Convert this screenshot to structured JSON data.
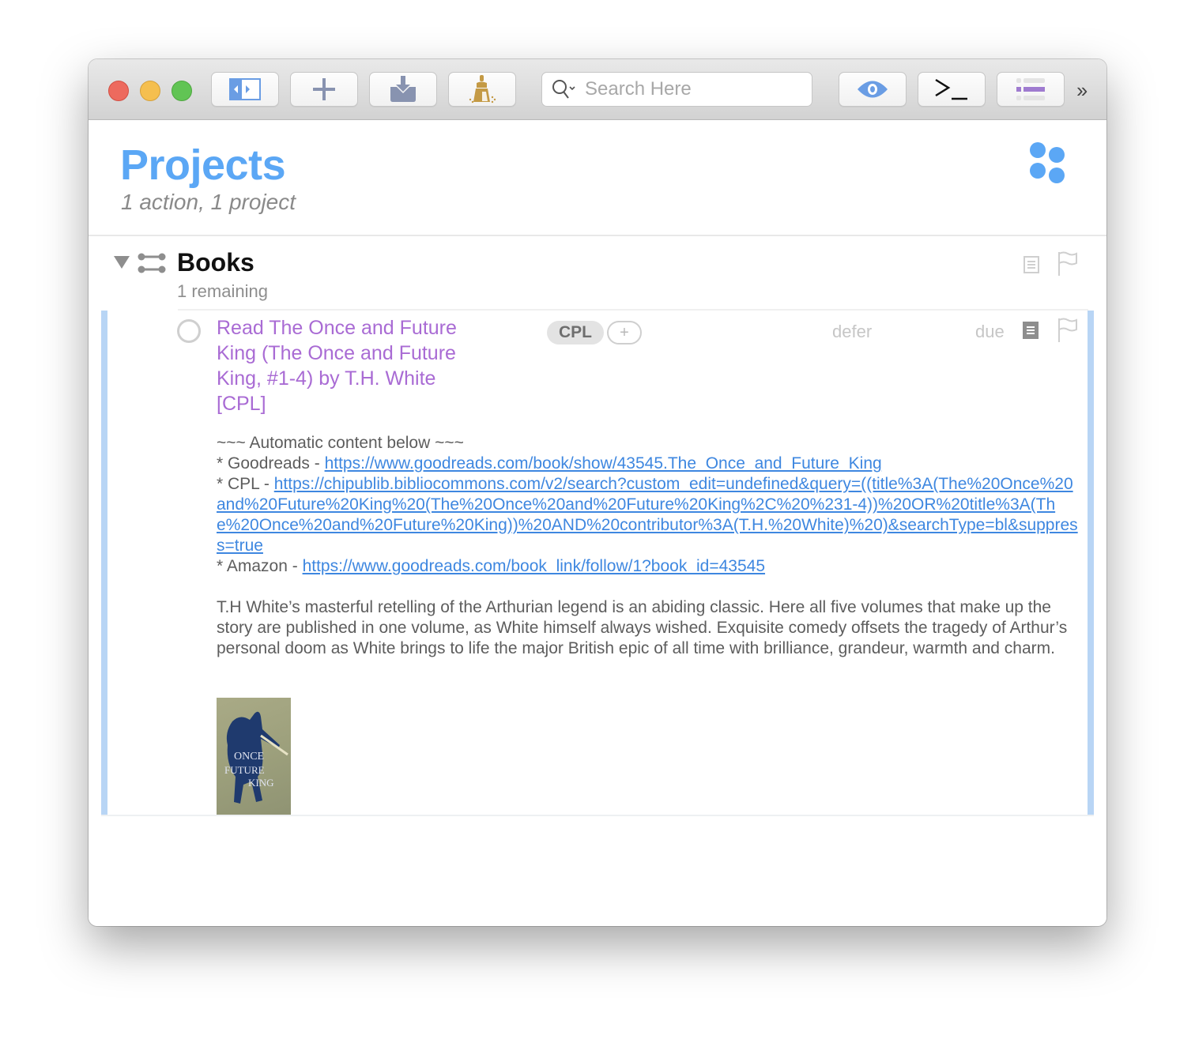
{
  "window": {
    "traffic_lights": [
      "close",
      "minimize",
      "zoom"
    ]
  },
  "toolbar": {
    "buttons": [
      {
        "name": "sidebar-toggle",
        "icon": "sidebar-toggle-icon"
      },
      {
        "name": "new-item",
        "icon": "plus-icon"
      },
      {
        "name": "inbox",
        "icon": "inbox-download-icon"
      },
      {
        "name": "clean-up",
        "icon": "broom-icon"
      },
      {
        "name": "view-options",
        "icon": "eye-icon"
      },
      {
        "name": "automation-console",
        "icon": "terminal-prompt-icon"
      },
      {
        "name": "outline-view",
        "icon": "list-icon"
      }
    ],
    "search_placeholder": "Search Here",
    "search_value": "",
    "overflow_label": "››",
    "colors": {
      "accent_blue": "#6a9de4",
      "slate": "#8893b0",
      "broom_gold": "#c49a45",
      "list_purple": "#9f7bd0"
    }
  },
  "header": {
    "title": "Projects",
    "subtitle": "1 action, 1 project",
    "title_color": "#5ba7f5"
  },
  "project": {
    "title": "Books",
    "remaining": "1 remaining",
    "expanded": true,
    "flagged": false
  },
  "action": {
    "title": "Read The Once and Future King (The Once and Future King, #1-4) by T.H. White [CPL]",
    "title_color": "#a96bd4",
    "completed": false,
    "tags": [
      "CPL"
    ],
    "add_tag_label": "+",
    "defer_placeholder": "defer",
    "due_placeholder": "due",
    "has_note": true,
    "flagged": false,
    "note": {
      "header": "~~~ Automatic content below ~~~",
      "links": [
        {
          "label": "* Goodreads - ",
          "url": "https://www.goodreads.com/book/show/43545.The_Once_and_Future_King"
        },
        {
          "label": "* CPL - ",
          "url": "https://chipublib.bibliocommons.com/v2/search?custom_edit=undefined&query=((title%3A(The%20Once%20and%20Future%20King%20(The%20Once%20and%20Future%20King%2C%20%231-4))%20OR%20title%3A(The%20Once%20and%20Future%20King))%20AND%20contributor%3A(T.H.%20White)%20)&searchType=bl&suppress=true"
        },
        {
          "label": "* Amazon - ",
          "url": "https://www.goodreads.com/book_link/follow/1?book_id=43545"
        }
      ],
      "description": "T.H White’s masterful retelling of the Arthurian legend is an abiding classic. Here all five volumes that make up the story are published in one volume, as White himself always wished. Exquisite comedy offsets the tragedy of Arthur’s personal doom as White brings to life the major British epic of all time with brilliance, grandeur, warmth and charm.",
      "cover_image": {
        "alt": "The Once and Future King book cover",
        "text_lines": [
          "ONCE",
          "FUTURE",
          "KING"
        ]
      }
    }
  }
}
